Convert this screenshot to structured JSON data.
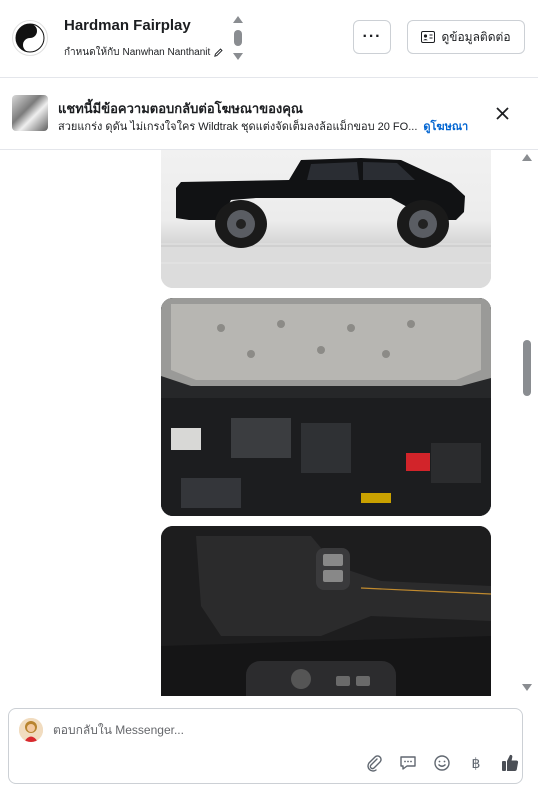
{
  "header": {
    "name": "Hardman Fairplay",
    "assigned_label": "กำหนดให้กับ",
    "assigned_to": "Nanwhan Nanthanit",
    "more_label": "···",
    "contact_button_label": "ดูข้อมูลติดต่อ"
  },
  "ad_banner": {
    "title": "แชทนี้มีข้อความตอบกลับต่อโฆษณาของคุณ",
    "description": "สวยแกร่ง ดุดัน ไม่เกรงใจใคร Wildtrak ชุดแต่งจัดเต็มลงล้อแม็กขอบ 20 FO...",
    "link_label": "ดูโฆษณา"
  },
  "composer": {
    "placeholder": "ตอบกลับใน Messenger..."
  },
  "icons": [
    "yin-yang-icon",
    "pencil-icon",
    "contact-card-icon",
    "close-icon",
    "paperclip-icon",
    "quick-reply-icon",
    "emoji-icon",
    "baht-icon",
    "thumbs-up-icon"
  ],
  "colors": {
    "link": "#0064d1",
    "border": "#ccd0d5",
    "icon": "#606770"
  }
}
